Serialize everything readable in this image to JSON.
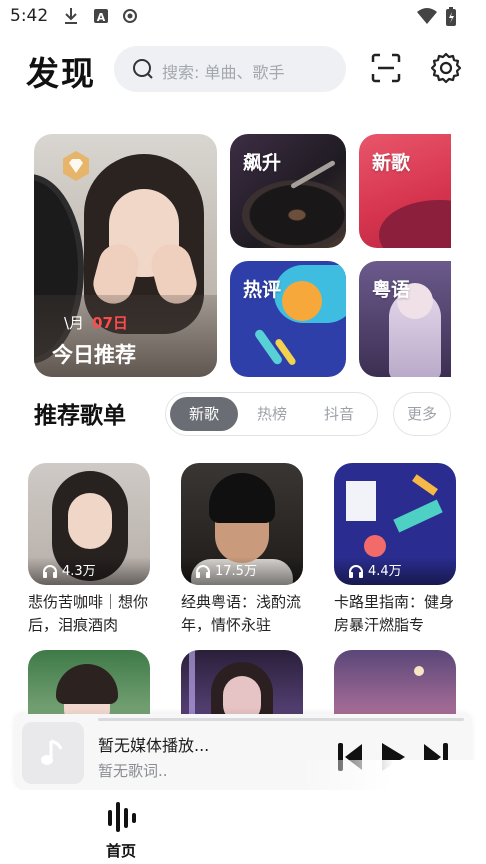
{
  "status_bar": {
    "time": "5:42",
    "icons": [
      "download-icon",
      "a-box-icon",
      "record-icon",
      "wifi-icon",
      "battery-icon"
    ]
  },
  "header": {
    "title": "发现",
    "search_placeholder": "搜索: 单曲、歌手",
    "icons": [
      "search-icon",
      "scan-icon",
      "settings-icon"
    ]
  },
  "banner": {
    "today": {
      "date_month": "\\月",
      "date_day": "07日",
      "title": "今日推荐"
    },
    "cards": [
      {
        "label": "飙升"
      },
      {
        "label": "新歌"
      },
      {
        "label": "热评"
      },
      {
        "label": "粤语"
      }
    ]
  },
  "recommend": {
    "title": "推荐歌单",
    "tabs": [
      {
        "label": "新歌",
        "active": true
      },
      {
        "label": "热榜",
        "active": false
      },
      {
        "label": "抖音",
        "active": false
      }
    ],
    "more_label": "更多",
    "playlists": [
      {
        "plays": "4.3万",
        "name": "悲伤苦咖啡｜想你后，泪痕酒肉"
      },
      {
        "plays": "17.5万",
        "name": "经典粤语：浅酌流年，情怀永驻"
      },
      {
        "plays": "4.4万",
        "name": "卡路里指南：健身房暴汗燃脂专"
      },
      {
        "plays": "",
        "name": ""
      },
      {
        "plays": "",
        "name": ""
      },
      {
        "plays": "",
        "name": ""
      }
    ]
  },
  "player": {
    "title": "暂无媒体播放...",
    "lyrics": "暂无歌词..",
    "icons": [
      "music-note-icon",
      "previous-icon",
      "play-icon",
      "next-icon"
    ]
  },
  "bottom_nav": {
    "items": [
      {
        "label": "首页",
        "icon": "equalizer-icon",
        "active": true
      }
    ]
  },
  "colors": {
    "tab_active": "#6a6d73",
    "accent_red": "#ff4b4b",
    "search_bg": "#eef0f4"
  }
}
